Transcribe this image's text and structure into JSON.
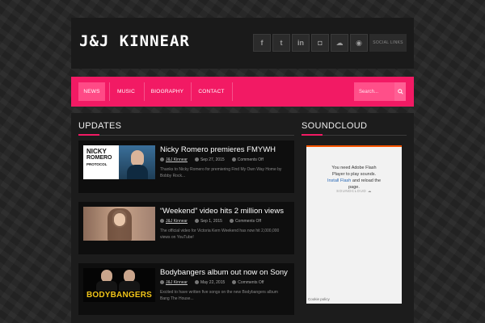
{
  "header": {
    "site_title": "J&J KINNEAR",
    "social": [
      {
        "icon": "facebook-icon",
        "glyph": "f"
      },
      {
        "icon": "twitter-icon",
        "glyph": "t"
      },
      {
        "icon": "linkedin-icon",
        "glyph": "in"
      },
      {
        "icon": "instagram-icon",
        "glyph": "◘"
      },
      {
        "icon": "soundcloud-icon",
        "glyph": "☁"
      },
      {
        "icon": "rss-icon",
        "glyph": "◉"
      }
    ],
    "social_tag": "SOCIAL LINKS"
  },
  "nav": {
    "items": [
      "NEWS",
      "MUSIC",
      "BIOGRAPHY",
      "CONTACT"
    ],
    "active": "NEWS",
    "search_placeholder": "Search..."
  },
  "updates": {
    "heading": "UPDATES",
    "posts": [
      {
        "title": "Nicky Romero premieres FMYWH",
        "author": "J&J Kinnear",
        "date": "Sep 27, 2015",
        "comments": "Comments Off",
        "excerpt": "Thanks to Nicky Romero for premiering Find My Own Way Home by Bobby Rock...",
        "thumb_lines": [
          "NICKY",
          "ROMERO",
          "PROTOCOL"
        ]
      },
      {
        "title": "“Weekend” video hits 2 million views",
        "author": "J&J Kinnear",
        "date": "Sep 1, 2015",
        "comments": "Comments Off",
        "excerpt": "The official video for Victoria Kern Weekend has now hit 2,000,000 views on YouTube!",
        "thumb_lines": []
      },
      {
        "title": "Bodybangers album out now on Sony",
        "author": "J&J Kinnear",
        "date": "May 22, 2015",
        "comments": "Comments Off",
        "excerpt": "Excited to have written five songs on the new Bodybangers album Bang The House...",
        "thumb_lines": [
          "BODYBANGERS"
        ]
      }
    ]
  },
  "soundcloud": {
    "heading": "SOUNDCLOUD",
    "line1": "You need Adobe Flash",
    "line2": "Player to play sounds.",
    "link": "Install Flash",
    "line3": "and reload the",
    "line4": "page.",
    "logo": "SOUNDCLOUD",
    "policy": "Cookie policy"
  },
  "colors": {
    "accent": "#f21a64",
    "soundcloud_orange": "#ff5500"
  }
}
